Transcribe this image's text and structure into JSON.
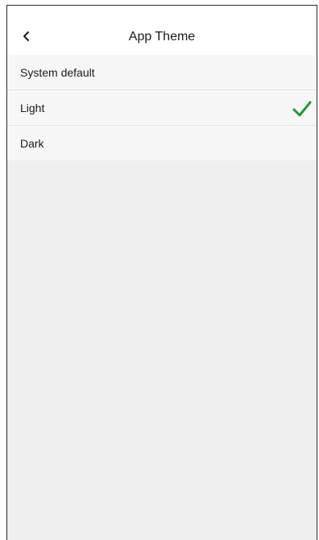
{
  "header": {
    "title": "App Theme",
    "back_icon": "chevron-left-icon"
  },
  "options": [
    {
      "label": "System default",
      "selected": false
    },
    {
      "label": "Light",
      "selected": true
    },
    {
      "label": "Dark",
      "selected": false
    }
  ],
  "colors": {
    "checkmark": "#1e9a2e",
    "background": "#efefef",
    "row_background": "#f7f7f7"
  }
}
